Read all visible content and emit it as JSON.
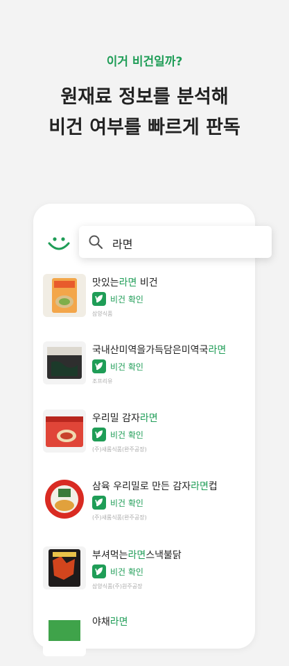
{
  "header": {
    "eyebrow": "이거 비건일까?",
    "line1": "원재료 정보를 분석해",
    "line2": "비건 여부를 빠르게 판독"
  },
  "search": {
    "query": "라면"
  },
  "results": [
    {
      "pre": "맛있는",
      "hl": "라면",
      "post": " 비건",
      "badge": "비건 확인",
      "maker": "삼양식품"
    },
    {
      "pre": "국내산미역을가득담은미역국",
      "hl": "라면",
      "post": "",
      "badge": "비건 확인",
      "maker": "조프리유"
    },
    {
      "pre": "우리밀 감자",
      "hl": "라면",
      "post": "",
      "badge": "비건 확인",
      "maker": "(주)새롬식품(완주공장)"
    },
    {
      "pre": "삼육 우리밀로 만든 감자",
      "hl": "라면",
      "post": "컵",
      "badge": "비건 확인",
      "maker": "(주)새롬식품(완주공장)"
    },
    {
      "pre": "부셔먹는",
      "hl": "라면",
      "post": "스낵불닭",
      "badge": "비건 확인",
      "maker": "삼양식품(주)원주공장"
    },
    {
      "pre": "야채",
      "hl": "라면",
      "post": "",
      "badge": "",
      "maker": ""
    }
  ],
  "colors": {
    "accent": "#1f9d57",
    "background": "#f3f3f3"
  },
  "icons": {
    "logo": "smile-logo-icon",
    "search": "search-icon",
    "badge": "leaf-icon"
  }
}
